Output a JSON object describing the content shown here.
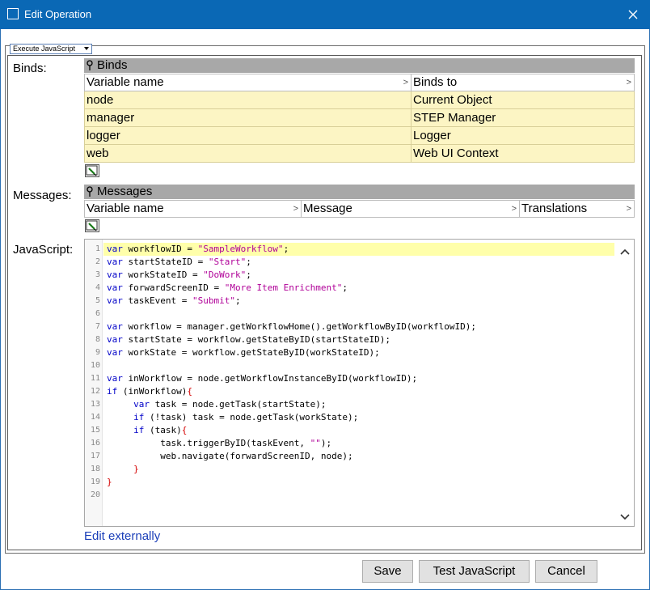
{
  "window": {
    "title": "Edit Operation"
  },
  "operation_type": {
    "selected": "Execute JavaScript"
  },
  "labels": {
    "binds": "Binds:",
    "messages": "Messages:",
    "javascript": "JavaScript:"
  },
  "binds_section": {
    "title": "Binds",
    "columns": [
      "Variable name",
      "Binds to"
    ],
    "rows": [
      {
        "variable": "node",
        "binds_to": "Current Object"
      },
      {
        "variable": "manager",
        "binds_to": "STEP Manager"
      },
      {
        "variable": "logger",
        "binds_to": "Logger"
      },
      {
        "variable": "web",
        "binds_to": "Web UI Context"
      }
    ]
  },
  "messages_section": {
    "title": "Messages",
    "columns": [
      "Variable name",
      "Message",
      "Translations"
    ]
  },
  "code": {
    "line_numbers": [
      "1",
      "2",
      "3",
      "4",
      "5",
      "6",
      "7",
      "8",
      "9",
      "10",
      "11",
      "12",
      "13",
      "14",
      "15",
      "16",
      "17",
      "18",
      "19",
      "20"
    ],
    "lines": [
      "var workflowID = \"SampleWorkflow\";",
      "var startStateID = \"Start\";",
      "var workStateID = \"DoWork\";",
      "var forwardScreenID = \"More Item Enrichment\";",
      "var taskEvent = \"Submit\";",
      "",
      "var workflow = manager.getWorkflowHome().getWorkflowByID(workflowID);",
      "var startState = workflow.getStateByID(startStateID);",
      "var workState = workflow.getStateByID(workStateID);",
      "",
      "var inWorkflow = node.getWorkflowInstanceByID(workflowID);",
      "if (inWorkflow){",
      "     var task = node.getTask(startState);",
      "     if (!task) task = node.getTask(workState);",
      "     if (task){",
      "          task.triggerByID(taskEvent, \"\");",
      "          web.navigate(forwardScreenID, node);",
      "     }",
      "}",
      ""
    ]
  },
  "edit_externally_link": "Edit externally",
  "buttons": {
    "save": "Save",
    "test": "Test JavaScript",
    "cancel": "Cancel"
  },
  "icons": {
    "app": "window-icon",
    "close": "close-icon",
    "pin": "pin-icon",
    "edit": "edit-table-icon",
    "scroll_up": "chevron-up-icon",
    "scroll_down": "chevron-down-icon"
  },
  "colors": {
    "titlebar": "#0a68b5",
    "keyword": "#0000c8",
    "string": "#b00098",
    "bracket": "#d40000",
    "row_fill": "#fcf5c4",
    "section_header": "#a8a8a8",
    "link": "#1a3eb8"
  }
}
